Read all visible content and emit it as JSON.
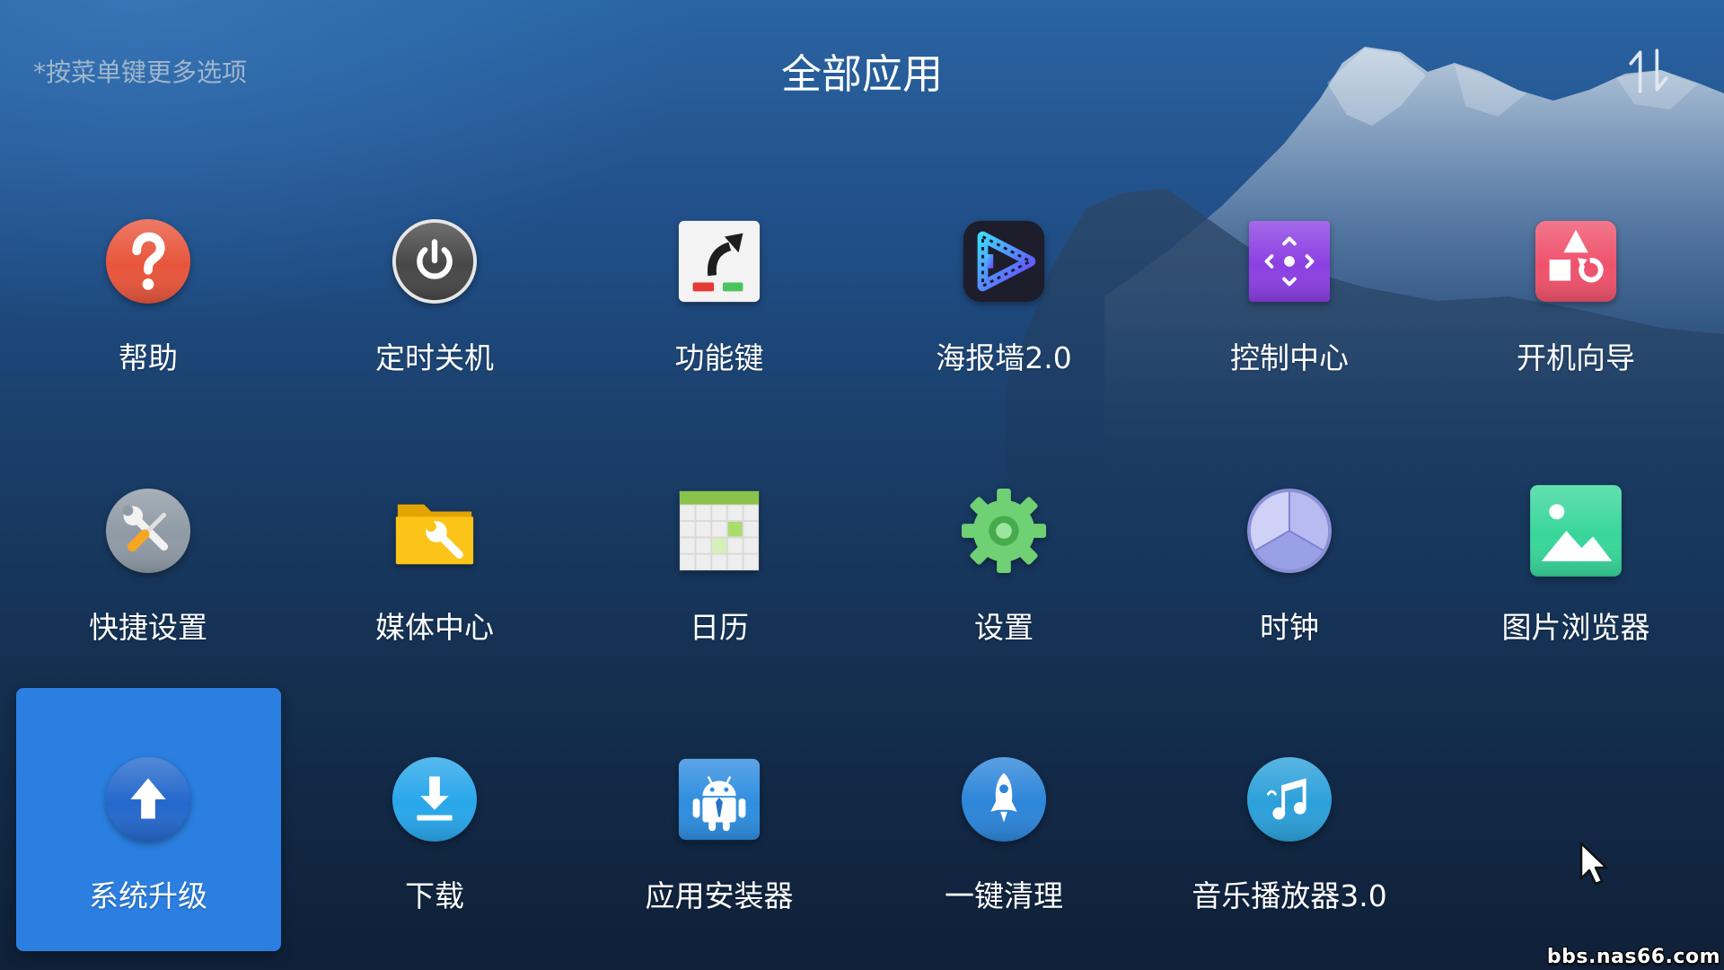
{
  "header": {
    "hint": "*按菜单键更多选项",
    "title": "全部应用",
    "sort_icon": "sort-icon"
  },
  "apps": [
    {
      "label": "帮助",
      "icon": "help-icon",
      "color": "#e8553b"
    },
    {
      "label": "定时关机",
      "icon": "power-icon",
      "color": "#474747"
    },
    {
      "label": "功能键",
      "icon": "function-key-icon",
      "color": "#f3f3f3"
    },
    {
      "label": "海报墙2.0",
      "icon": "poster-wall-icon",
      "color": "#1d1d2b"
    },
    {
      "label": "控制中心",
      "icon": "control-center-icon",
      "color": "#8b3fe2"
    },
    {
      "label": "开机向导",
      "icon": "boot-wizard-icon",
      "color": "#ef526b"
    },
    {
      "label": "快捷设置",
      "icon": "tools-icon",
      "color": "#8f9aa5"
    },
    {
      "label": "媒体中心",
      "icon": "media-folder-icon",
      "color": "#fcc419"
    },
    {
      "label": "日历",
      "icon": "calendar-icon",
      "color": "#d9d9d9"
    },
    {
      "label": "设置",
      "icon": "gear-icon",
      "color": "#70d074"
    },
    {
      "label": "时钟",
      "icon": "clock-icon",
      "color": "#b7bbf0"
    },
    {
      "label": "图片浏览器",
      "icon": "image-viewer-icon",
      "color": "#38d69b"
    },
    {
      "label": "系统升级",
      "icon": "upgrade-arrow-icon",
      "color": "#2468cc",
      "selected": true
    },
    {
      "label": "下载",
      "icon": "download-icon",
      "color": "#28a6ea"
    },
    {
      "label": "应用安装器",
      "icon": "android-installer-icon",
      "color": "#2e8de0"
    },
    {
      "label": "一键清理",
      "icon": "rocket-cleaner-icon",
      "color": "#2c85d9"
    },
    {
      "label": "音乐播放器3.0",
      "icon": "music-notes-icon",
      "color": "#2ba0da"
    }
  ],
  "colors": {
    "selected_tile": "#2b7fe1",
    "background_top": "#2a64a2",
    "background_bottom": "#0f2038"
  },
  "watermark": "bbs.nas66.com"
}
